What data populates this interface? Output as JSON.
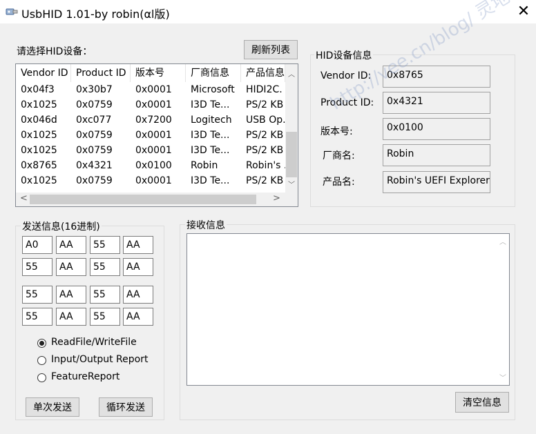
{
  "window": {
    "title": "UsbHID 1.01-by robin(αl版)"
  },
  "device_select": {
    "label": "请选择HID设备：",
    "refresh_button": "刷新列表",
    "columns": [
      "Vendor ID",
      "Product ID",
      "版本号",
      "厂商信息",
      "产品信息"
    ],
    "rows": [
      [
        "0x04f3",
        "0x30b7",
        "0x0001",
        "Microsoft",
        "HIDI2C."
      ],
      [
        "0x1025",
        "0x0759",
        "0x0001",
        "I3D Te...",
        "PS/2 KB"
      ],
      [
        "0x046d",
        "0xc077",
        "0x7200",
        "Logitech",
        "USB Op."
      ],
      [
        "0x1025",
        "0x0759",
        "0x0001",
        "I3D Te...",
        "PS/2 KB"
      ],
      [
        "0x1025",
        "0x0759",
        "0x0001",
        "I3D Te...",
        "PS/2 KB"
      ],
      [
        "0x8765",
        "0x4321",
        "0x0100",
        "Robin",
        "Robin's ."
      ],
      [
        "0x1025",
        "0x0759",
        "0x0001",
        "I3D Te...",
        "PS/2 KB"
      ]
    ]
  },
  "device_info": {
    "title": "HID设备信息",
    "fields": [
      {
        "label": "Vendor ID:",
        "value": "0x8765"
      },
      {
        "label": "Product ID:",
        "value": "0x4321"
      },
      {
        "label": "版本号:",
        "value": "0x0100"
      },
      {
        "label": "厂商名:",
        "value": "Robin"
      },
      {
        "label": "产品名:",
        "value": "Robin's UEFI Explorer"
      }
    ]
  },
  "watermark": "http://vee.cn/blog/ 灵地 罗冰(Robin)",
  "send": {
    "title": "发送信息(16进制)",
    "hex": [
      [
        "A0",
        "AA",
        "55",
        "AA"
      ],
      [
        "55",
        "AA",
        "55",
        "AA"
      ],
      [
        "55",
        "AA",
        "55",
        "AA"
      ],
      [
        "55",
        "AA",
        "55",
        "AA"
      ]
    ],
    "modes": [
      {
        "label": "ReadFile/WriteFile",
        "selected": true
      },
      {
        "label": "Input/Output Report",
        "selected": false
      },
      {
        "label": "FeatureReport",
        "selected": false
      }
    ],
    "single_send_button": "单次发送",
    "loop_send_button": "循环发送"
  },
  "receive": {
    "title": "接收信息",
    "content": "",
    "clear_button": "清空信息"
  }
}
